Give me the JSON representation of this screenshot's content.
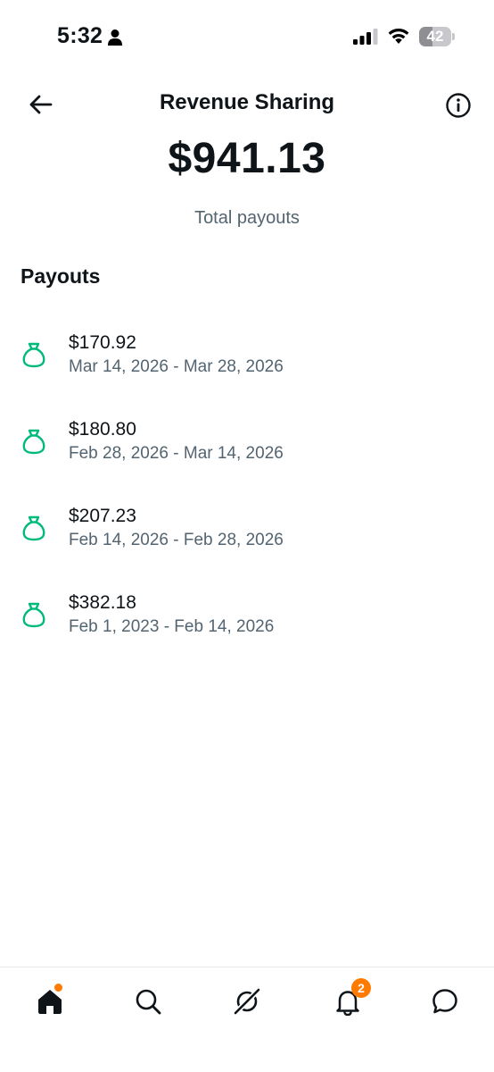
{
  "status_bar": {
    "time": "5:32",
    "battery_level": "42",
    "battery_fraction": 0.42
  },
  "header": {
    "title": "Revenue Sharing",
    "back_icon": "arrow-left-icon",
    "info_icon": "info-circle-icon"
  },
  "summary": {
    "total_amount": "$941.13",
    "total_label": "Total payouts"
  },
  "payouts": {
    "section_title": "Payouts",
    "icon": "money-bag-icon",
    "icon_color": "#00ba7c",
    "items": [
      {
        "amount": "$170.92",
        "range": "Mar 14, 2026 - Mar 28, 2026"
      },
      {
        "amount": "$180.80",
        "range": "Feb 28, 2026 - Mar 14, 2026"
      },
      {
        "amount": "$207.23",
        "range": "Feb 14, 2026 - Feb 28, 2026"
      },
      {
        "amount": "$382.18",
        "range": "Feb 1, 2023 - Feb 14, 2026"
      }
    ]
  },
  "bottom_nav": {
    "items": [
      {
        "icon": "home-icon",
        "active": true,
        "dot": true
      },
      {
        "icon": "search-icon"
      },
      {
        "icon": "grok-icon"
      },
      {
        "icon": "bell-icon",
        "badge": "2"
      },
      {
        "icon": "messages-icon"
      }
    ],
    "accent_color": "#ff7a00"
  }
}
